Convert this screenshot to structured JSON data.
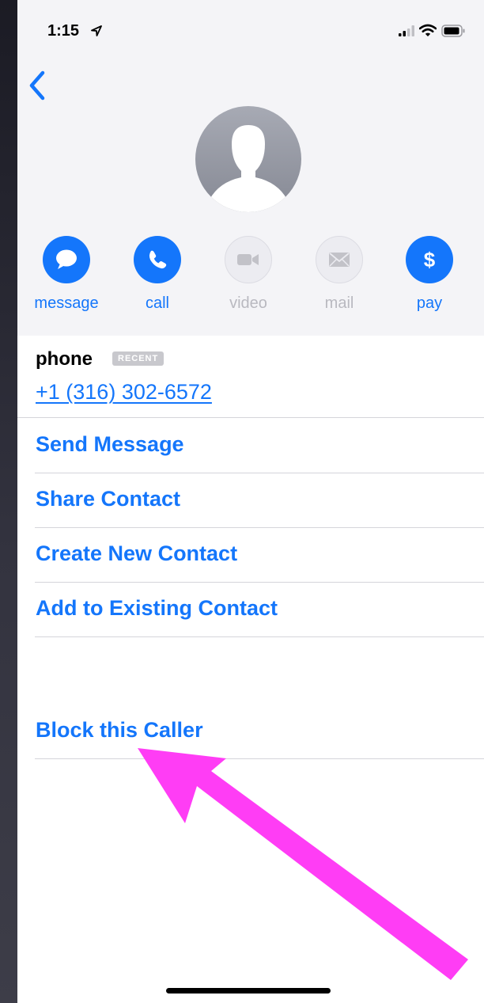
{
  "status_bar": {
    "time": "1:15"
  },
  "actions": [
    {
      "label": "message",
      "icon": "message-bubble-icon",
      "enabled": true
    },
    {
      "label": "call",
      "icon": "phone-icon",
      "enabled": true
    },
    {
      "label": "video",
      "icon": "video-camera-icon",
      "enabled": false
    },
    {
      "label": "mail",
      "icon": "envelope-icon",
      "enabled": false
    },
    {
      "label": "pay",
      "icon": "dollar-icon",
      "enabled": true,
      "glyph": "$"
    }
  ],
  "phone_field": {
    "label": "phone",
    "badge": "RECENT",
    "number": "+1 (316) 302-6572"
  },
  "menu": {
    "send_message": "Send Message",
    "share_contact": "Share Contact",
    "create_new_contact": "Create New Contact",
    "add_to_existing": "Add to Existing Contact",
    "block_caller": "Block this Caller"
  },
  "colors": {
    "accent": "#1476fb",
    "annotation_arrow": "#ff3df5",
    "disabled": "#b9b9c0",
    "header_bg": "#f4f4f7"
  }
}
